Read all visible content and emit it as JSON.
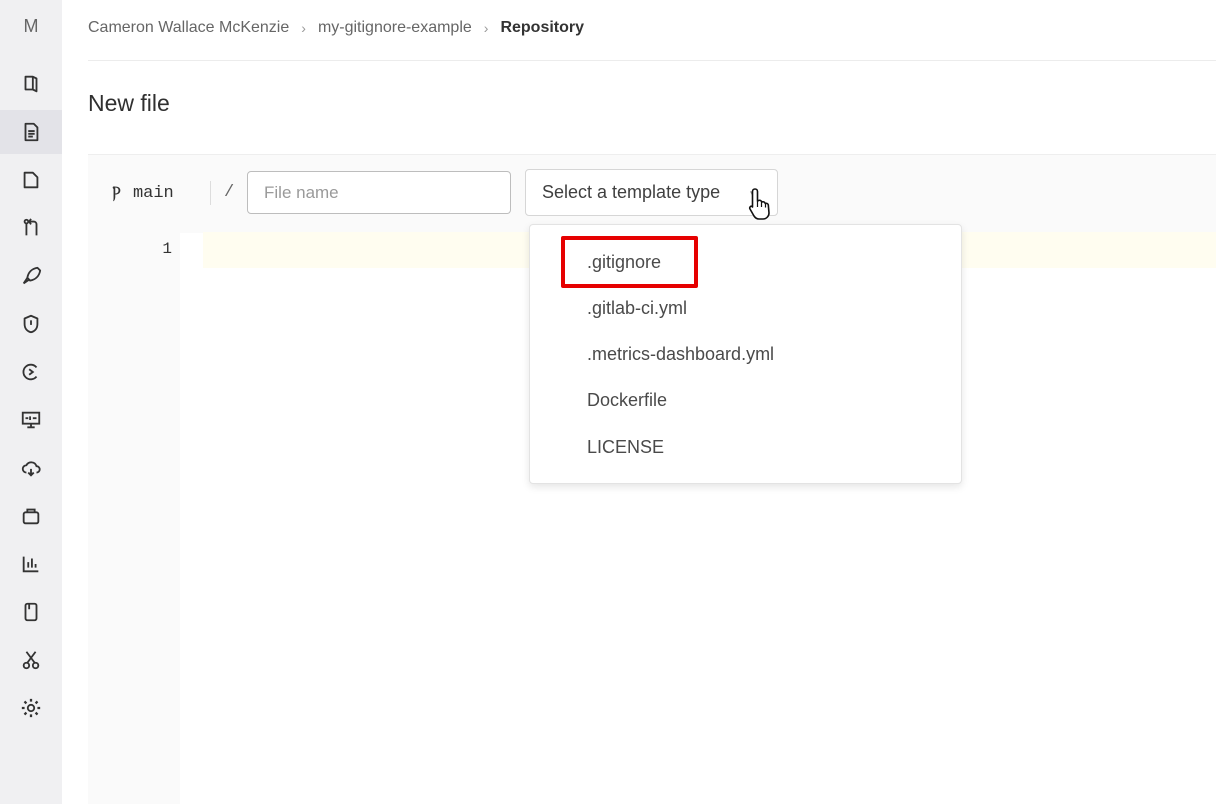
{
  "sidebar": {
    "project_avatar": "M",
    "items": [
      {
        "icon": "project-overview-icon"
      },
      {
        "icon": "repository-icon",
        "active": true
      },
      {
        "icon": "issues-icon"
      },
      {
        "icon": "merge-requests-icon"
      },
      {
        "icon": "cicd-rocket-icon"
      },
      {
        "icon": "security-shield-icon"
      },
      {
        "icon": "deployments-icon"
      },
      {
        "icon": "monitor-icon"
      },
      {
        "icon": "infrastructure-cloud-icon"
      },
      {
        "icon": "packages-icon"
      },
      {
        "icon": "analytics-icon"
      },
      {
        "icon": "wiki-icon"
      },
      {
        "icon": "snippets-scissors-icon"
      },
      {
        "icon": "settings-gear-icon"
      }
    ]
  },
  "breadcrumb": {
    "items": [
      "Cameron Wallace McKenzie",
      "my-gitignore-example",
      "Repository"
    ],
    "separator": "›"
  },
  "page": {
    "title": "New file"
  },
  "editor": {
    "branch": "main",
    "path_separator": "/",
    "file_name": {
      "value": "",
      "placeholder": "File name"
    },
    "template_select": {
      "label": "Select a template type",
      "options": [
        ".gitignore",
        ".gitlab-ci.yml",
        ".metrics-dashboard.yml",
        "Dockerfile",
        "LICENSE"
      ],
      "highlighted_option": ".gitignore"
    },
    "line_numbers": [
      "1"
    ]
  },
  "colors": {
    "highlight": "#e60000",
    "sidebar_bg": "#f0f0f2"
  }
}
